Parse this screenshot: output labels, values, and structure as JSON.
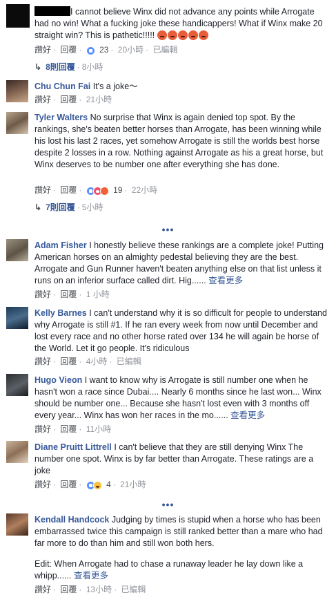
{
  "labels": {
    "like": "讚好",
    "reply": "回覆",
    "dot": "·",
    "edited": "已編輯",
    "see_more": "查看更多",
    "more_dots": "•••"
  },
  "comments": [
    {
      "author": "",
      "text": "I cannot believe Winx did not advance any points while Arrogate had no win! What a fucking joke these handicappers! What if Winx make 20 straight win? This is pathetic!!!!!",
      "reaction_count": "23",
      "time": "20小時",
      "replies_label": "8則回覆",
      "replies_time": "8小時"
    },
    {
      "author": "Chu Chun Fai",
      "text": "It's a joke〜",
      "time": "21小時"
    },
    {
      "author": "Tyler Walters",
      "text": "No surprise that Winx is again denied top spot. By the rankings, she's beaten better horses than Arrogate, has been winning while his lost his last 2 races, yet somehow Arrogate is still the worlds best horse despite 2 losses in a row. Nothing against Arrogate as his a great horse, but Winx deserves to be number one after everything she has done.",
      "reaction_count": "19",
      "time": "22小時",
      "replies_label": "7則回覆",
      "replies_time": "5小時"
    },
    {
      "author": "Adam Fisher",
      "text": "I honestly believe these rankings are a complete joke! Putting American horses on an almighty pedestal believing they are the best. Arrogate and Gun Runner haven't beaten anything else on that list unless it runs on an inferior surface called dirt. Hig......",
      "time": "1 小時"
    },
    {
      "author": "Kelly Barnes",
      "text": "I can't understand why it is so difficult for people to understand why Arrogate is still #1. If he ran every week from now until December and lost every race and no other horse rated over 134 he will again be horse of the World. Let it go people. It's ridiculous",
      "time": "4小時"
    },
    {
      "author": "Hugo Vieon",
      "text": "I want to know why is Arrogate is still number one when he hasn't won a race since Dubai.... Nearly 6 months since he last won... Winx should be number one... Because she hasn't lost even with 3 months off every year... Winx has won her races in the mo......",
      "time": "11小時"
    },
    {
      "author": "Diane Pruitt Littrell",
      "text": "I can't believe that they are still denying Winx The number one spot. Winx is by far better than Arrogate. These ratings are a joke",
      "reaction_count": "4",
      "time": "21小時"
    },
    {
      "author": "Kendall Handcock",
      "text": "Judging by times is stupid when a horse who has been embarrassed twice this campaign is still ranked better than a mare who had far more to do than him and still won both hers.",
      "text2": "Edit: When Arrogate had to chase a runaway leader he lay down like a whipp......",
      "time": "13小時"
    }
  ],
  "colors": {
    "link": "#365899",
    "meta": "#90949c",
    "action": "#4b4f56"
  }
}
